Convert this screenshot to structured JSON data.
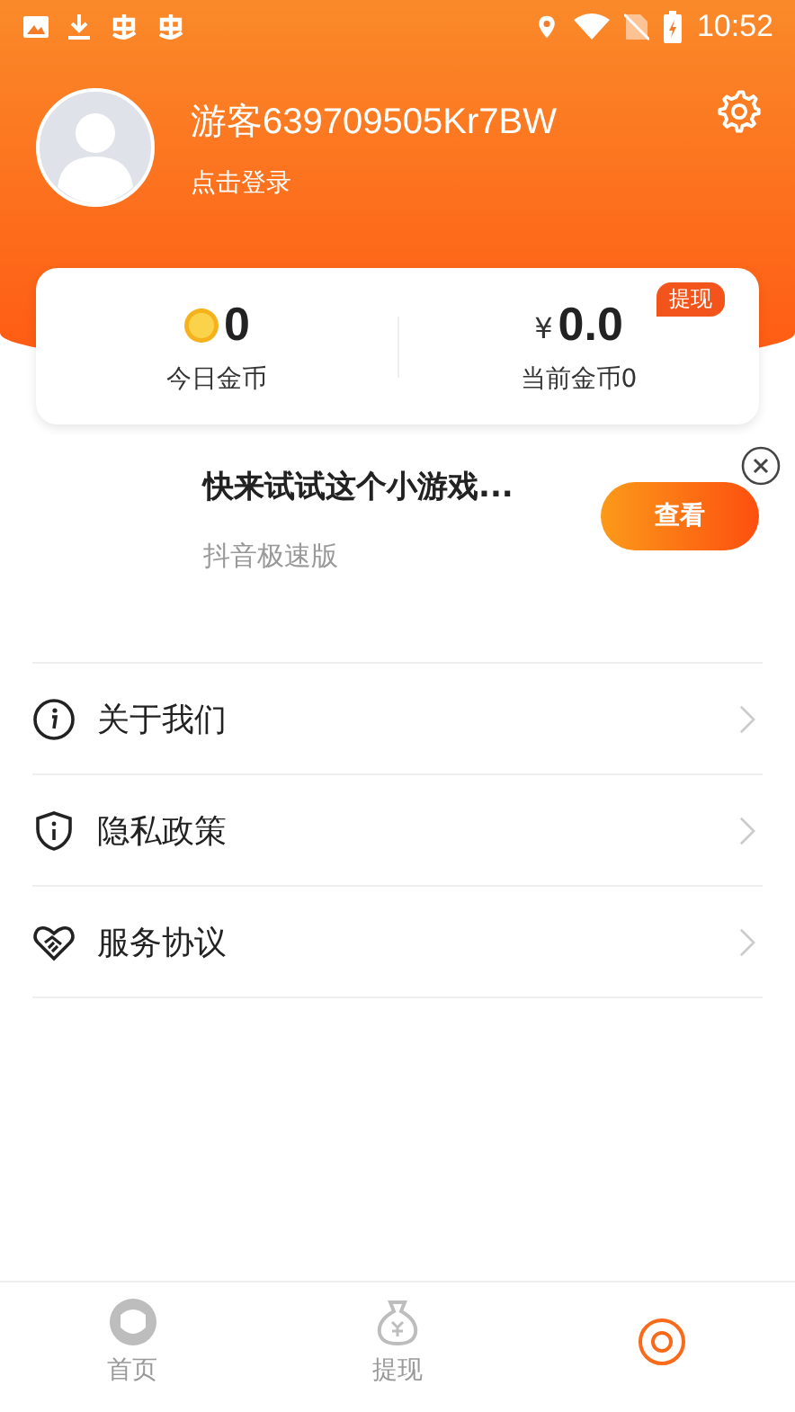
{
  "status_bar": {
    "time": "10:52"
  },
  "profile": {
    "username": "游客639709505Kr7BW",
    "login_link": "点击登录"
  },
  "wallet": {
    "today_coins": {
      "value": "0",
      "label": "今日金币"
    },
    "balance": {
      "currency": "¥",
      "value": "0.0",
      "label": "当前金币0",
      "badge": "提现"
    }
  },
  "ad": {
    "title": "快来试试这个小游戏...",
    "subtitle": "抖音极速版",
    "button": "查看"
  },
  "menu": [
    {
      "kind": "info",
      "label": "关于我们"
    },
    {
      "kind": "privacy",
      "label": "隐私政策"
    },
    {
      "kind": "agreement",
      "label": "服务协议"
    }
  ],
  "tabs": [
    {
      "kind": "home",
      "label": "首页",
      "selected": false
    },
    {
      "kind": "withdraw",
      "label": "提现",
      "selected": false
    },
    {
      "kind": "mine",
      "selected": true
    }
  ]
}
